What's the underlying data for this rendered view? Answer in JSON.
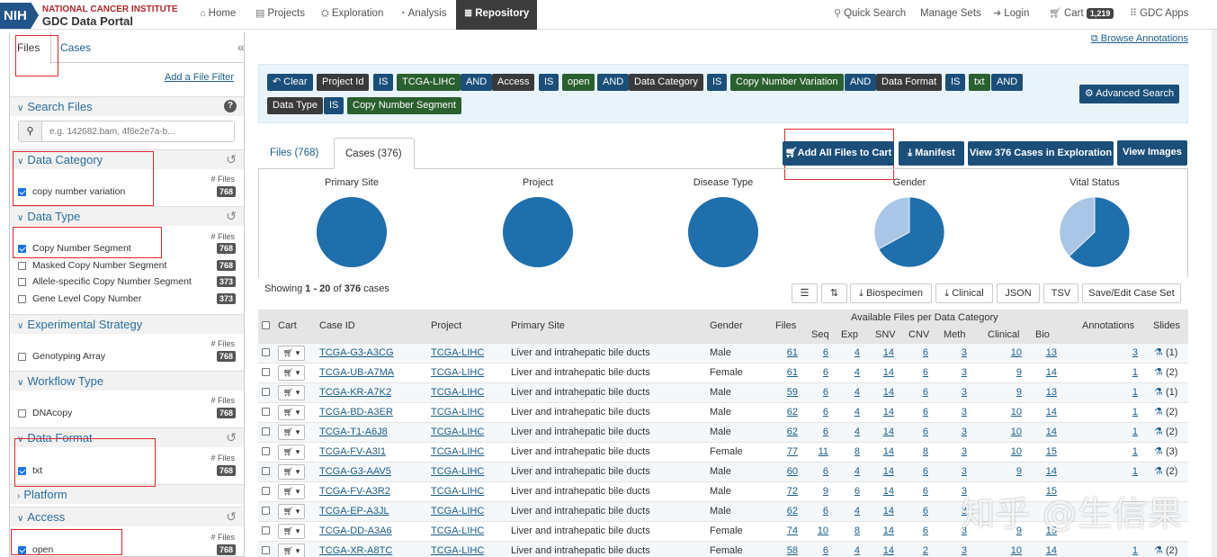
{
  "header": {
    "logo_abbr": "NIH",
    "institute": "NATIONAL CANCER INSTITUTE",
    "portal": "GDC Data Portal",
    "nav": [
      {
        "label": "Home",
        "icon": "home-icon"
      },
      {
        "label": "Projects",
        "icon": "projects-icon"
      },
      {
        "label": "Exploration",
        "icon": "exploration-icon"
      },
      {
        "label": "Analysis",
        "icon": "analysis-icon"
      },
      {
        "label": "Repository",
        "icon": "database-icon",
        "active": true
      }
    ],
    "right": {
      "quick_search": "Quick Search",
      "manage_sets": "Manage Sets",
      "login": "Login",
      "cart": "Cart",
      "cart_count": "1,219",
      "gdc_apps": "GDC Apps"
    }
  },
  "sidebar": {
    "tabs": [
      "Files",
      "Cases"
    ],
    "collapse_glyph": "«",
    "add_filter": "Add a File Filter",
    "search": {
      "title": "Search Files",
      "placeholder": "e.g. 142682.bam, 4f6e2e7a-b..."
    },
    "files_header": "# Files",
    "facets": {
      "data_category": {
        "title": "Data Category",
        "items": [
          {
            "label": "copy number variation",
            "count": "768",
            "checked": true
          }
        ]
      },
      "data_type": {
        "title": "Data Type",
        "items": [
          {
            "label": "Copy Number Segment",
            "count": "768",
            "checked": true
          },
          {
            "label": "Masked Copy Number Segment",
            "count": "768",
            "checked": false
          },
          {
            "label": "Allele-specific Copy Number Segment",
            "count": "373",
            "checked": false
          },
          {
            "label": "Gene Level Copy Number",
            "count": "373",
            "checked": false
          }
        ]
      },
      "experimental_strategy": {
        "title": "Experimental Strategy",
        "items": [
          {
            "label": "Genotyping Array",
            "count": "768",
            "checked": false
          }
        ]
      },
      "workflow_type": {
        "title": "Workflow Type",
        "items": [
          {
            "label": "DNAcopy",
            "count": "768",
            "checked": false
          }
        ]
      },
      "data_format": {
        "title": "Data Format",
        "items": [
          {
            "label": "txt",
            "count": "768",
            "checked": true
          }
        ]
      },
      "platform": {
        "title": "Platform"
      },
      "access": {
        "title": "Access",
        "items": [
          {
            "label": "open",
            "count": "768",
            "checked": true
          }
        ]
      }
    }
  },
  "main": {
    "browse_annotations": "Browse Annotations",
    "query": {
      "clear": "Clear",
      "pills": [
        {
          "text": "Project Id",
          "kind": "field"
        },
        {
          "text": "IS",
          "kind": "op"
        },
        {
          "text": "TCGA-LIHC",
          "kind": "val"
        },
        {
          "text": "AND",
          "kind": "op"
        },
        {
          "text": "Access",
          "kind": "field"
        },
        {
          "text": "IS",
          "kind": "op"
        },
        {
          "text": "open",
          "kind": "val"
        },
        {
          "text": "AND",
          "kind": "op"
        },
        {
          "text": "Data Category",
          "kind": "field"
        },
        {
          "text": "IS",
          "kind": "op"
        },
        {
          "text": "Copy Number Variation",
          "kind": "val"
        },
        {
          "text": "AND",
          "kind": "op"
        },
        {
          "text": "Data Format",
          "kind": "field"
        },
        {
          "text": "IS",
          "kind": "op"
        },
        {
          "text": "txt",
          "kind": "val"
        },
        {
          "text": "AND",
          "kind": "op"
        },
        {
          "text": "Data Type",
          "kind": "field"
        },
        {
          "text": "IS",
          "kind": "op"
        },
        {
          "text": "Copy Number Segment",
          "kind": "val"
        }
      ],
      "advanced": "Advanced Search"
    },
    "tabs": {
      "files": "Files (768)",
      "cases": "Cases (376)"
    },
    "actions": {
      "add_all": "Add All Files to Cart",
      "manifest": "Manifest",
      "view_cases": "View 376 Cases in Exploration",
      "view_images": "View Images"
    },
    "charts": [
      {
        "title": "Primary Site",
        "slices": [
          1.0
        ]
      },
      {
        "title": "Project",
        "slices": [
          1.0
        ]
      },
      {
        "title": "Disease Type",
        "slices": [
          1.0
        ]
      },
      {
        "title": "Gender",
        "slices": [
          0.67,
          0.33
        ]
      },
      {
        "title": "Vital Status",
        "slices": [
          0.63,
          0.37
        ]
      }
    ],
    "chart_colors": [
      "#1f6fad",
      "#a9c6e6"
    ],
    "showing": {
      "prefix": "Showing ",
      "range": "1 - 20",
      "mid": " of ",
      "total": "376",
      "suffix": " cases"
    },
    "table_buttons": {
      "biospecimen": "Biospecimen",
      "clinical": "Clinical",
      "json": "JSON",
      "tsv": "TSV",
      "save_set": "Save/Edit Case Set"
    },
    "table": {
      "headers": {
        "cart": "Cart",
        "case_id": "Case ID",
        "project": "Project",
        "primary_site": "Primary Site",
        "gender": "Gender",
        "files": "Files",
        "avail": "Available Files per Data Category",
        "seq": "Seq",
        "exp": "Exp",
        "snv": "SNV",
        "cnv": "CNV",
        "meth": "Meth",
        "clinical": "Clinical",
        "bio": "Bio",
        "annotations": "Annotations",
        "slides": "Slides"
      },
      "rows": [
        {
          "case_id": "TCGA-G3-A3CG",
          "project": "TCGA-LIHC",
          "site": "Liver and intrahepatic bile ducts",
          "gender": "Male",
          "files": "61",
          "seq": "6",
          "exp": "4",
          "snv": "14",
          "cnv": "6",
          "meth": "3",
          "clinical": "10",
          "bio": "13",
          "ann": "3",
          "slides": "(1)"
        },
        {
          "case_id": "TCGA-UB-A7MA",
          "project": "TCGA-LIHC",
          "site": "Liver and intrahepatic bile ducts",
          "gender": "Female",
          "files": "61",
          "seq": "6",
          "exp": "4",
          "snv": "14",
          "cnv": "6",
          "meth": "3",
          "clinical": "9",
          "bio": "14",
          "ann": "1",
          "slides": "(2)"
        },
        {
          "case_id": "TCGA-KR-A7K2",
          "project": "TCGA-LIHC",
          "site": "Liver and intrahepatic bile ducts",
          "gender": "Male",
          "files": "59",
          "seq": "6",
          "exp": "4",
          "snv": "14",
          "cnv": "6",
          "meth": "3",
          "clinical": "9",
          "bio": "13",
          "ann": "1",
          "slides": "(1)"
        },
        {
          "case_id": "TCGA-BD-A3ER",
          "project": "TCGA-LIHC",
          "site": "Liver and intrahepatic bile ducts",
          "gender": "Male",
          "files": "62",
          "seq": "6",
          "exp": "4",
          "snv": "14",
          "cnv": "6",
          "meth": "3",
          "clinical": "10",
          "bio": "14",
          "ann": "1",
          "slides": "(2)"
        },
        {
          "case_id": "TCGA-T1-A6J8",
          "project": "TCGA-LIHC",
          "site": "Liver and intrahepatic bile ducts",
          "gender": "Male",
          "files": "62",
          "seq": "6",
          "exp": "4",
          "snv": "14",
          "cnv": "6",
          "meth": "3",
          "clinical": "10",
          "bio": "14",
          "ann": "1",
          "slides": "(2)"
        },
        {
          "case_id": "TCGA-FV-A3I1",
          "project": "TCGA-LIHC",
          "site": "Liver and intrahepatic bile ducts",
          "gender": "Female",
          "files": "77",
          "seq": "11",
          "exp": "8",
          "snv": "14",
          "cnv": "8",
          "meth": "3",
          "clinical": "10",
          "bio": "15",
          "ann": "1",
          "slides": "(3)"
        },
        {
          "case_id": "TCGA-G3-AAV5",
          "project": "TCGA-LIHC",
          "site": "Liver and intrahepatic bile ducts",
          "gender": "Male",
          "files": "60",
          "seq": "6",
          "exp": "4",
          "snv": "14",
          "cnv": "6",
          "meth": "3",
          "clinical": "9",
          "bio": "14",
          "ann": "1",
          "slides": "(2)"
        },
        {
          "case_id": "TCGA-FV-A3R2",
          "project": "TCGA-LIHC",
          "site": "Liver and intrahepatic bile ducts",
          "gender": "Male",
          "files": "72",
          "seq": "9",
          "exp": "6",
          "snv": "14",
          "cnv": "6",
          "meth": "3",
          "clinical": "",
          "bio": "15",
          "ann": "",
          "slides": ""
        },
        {
          "case_id": "TCGA-EP-A3JL",
          "project": "TCGA-LIHC",
          "site": "Liver and intrahepatic bile ducts",
          "gender": "Male",
          "files": "62",
          "seq": "6",
          "exp": "4",
          "snv": "14",
          "cnv": "6",
          "meth": "3",
          "clinical": "",
          "bio": "",
          "ann": "",
          "slides": ""
        },
        {
          "case_id": "TCGA-DD-A3A6",
          "project": "TCGA-LIHC",
          "site": "Liver and intrahepatic bile ducts",
          "gender": "Female",
          "files": "74",
          "seq": "10",
          "exp": "8",
          "snv": "14",
          "cnv": "6",
          "meth": "3",
          "clinical": "9",
          "bio": "15",
          "ann": "",
          "slides": ""
        },
        {
          "case_id": "TCGA-XR-A8TC",
          "project": "TCGA-LIHC",
          "site": "Liver and intrahepatic bile ducts",
          "gender": "Female",
          "files": "58",
          "seq": "6",
          "exp": "4",
          "snv": "14",
          "cnv": "2",
          "meth": "3",
          "clinical": "10",
          "bio": "14",
          "ann": "1",
          "slides": "(2)"
        }
      ]
    }
  },
  "watermark": "知乎 @生信果"
}
